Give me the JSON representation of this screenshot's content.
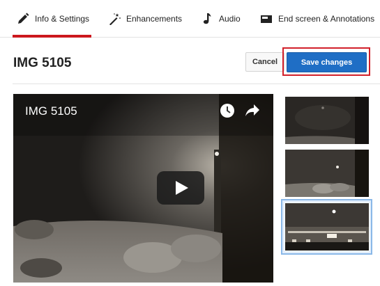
{
  "tabs": [
    {
      "label": "Info & Settings",
      "icon": "pencil-icon",
      "active": true
    },
    {
      "label": "Enhancements",
      "icon": "magic-wand-icon",
      "active": false
    },
    {
      "label": "Audio",
      "icon": "music-note-icon",
      "active": false
    },
    {
      "label": "End screen & Annotations",
      "icon": "end-screen-icon",
      "active": false
    }
  ],
  "header": {
    "title": "IMG 5105",
    "cancel_label": "Cancel",
    "save_label": "Save changes"
  },
  "player": {
    "title": "IMG 5105"
  },
  "thumbnails": {
    "count": 3,
    "selected_index": 3
  },
  "colors": {
    "accent_red": "#cc181e",
    "save_blue": "#1f6ec5",
    "selected_border": "#8ab8e8"
  }
}
